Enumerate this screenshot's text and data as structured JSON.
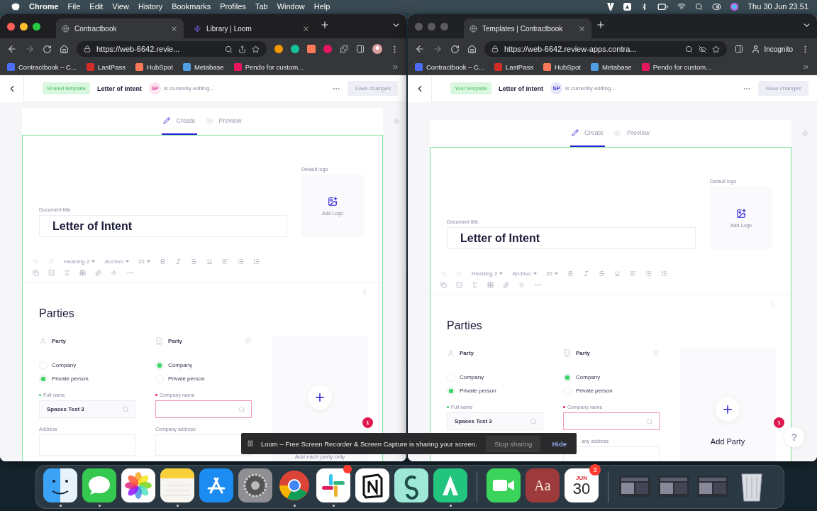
{
  "menubar": {
    "app": "Chrome",
    "menus": [
      "File",
      "Edit",
      "View",
      "History",
      "Bookmarks",
      "Profiles",
      "Tab",
      "Window",
      "Help"
    ],
    "clock": "Thu 30 Jun  23.51"
  },
  "windows": [
    {
      "active": true,
      "incognito": false,
      "tabs": [
        {
          "title": "Contractbook",
          "selected": true,
          "kind": "page"
        },
        {
          "title": "Library | Loom",
          "selected": false,
          "kind": "loom"
        }
      ],
      "url": "https://web-6642.revie...",
      "bookmarks": [
        {
          "label": "Contractbook – C...",
          "color": "#4a6cf7"
        },
        {
          "label": "LastPass",
          "color": "#d32d27"
        },
        {
          "label": "HubSpot",
          "color": "#ff7a59"
        },
        {
          "label": "Metabase",
          "color": "#509ee3"
        },
        {
          "label": "Pendo for custom...",
          "color": "#e8175d"
        }
      ],
      "page": {
        "badge": "Shared template",
        "title": "Letter of Intent",
        "avatar": "SP",
        "editing": "is currently editing...",
        "save": "Save changes",
        "modes": [
          {
            "label": "Create",
            "selected": true,
            "kind": "create"
          },
          {
            "label": "Preview",
            "selected": false,
            "kind": "preview"
          }
        ],
        "logo_label": "Default logo",
        "add_logo": "Add Logo",
        "doc_title_label": "Document title",
        "doc_title": "Letter of Intent",
        "heading": "Heading 2",
        "font": "Archivo",
        "size": "22",
        "section": "Parties",
        "parties": [
          {
            "title": "Party",
            "kind": "person",
            "name_label": "Full name",
            "name_value": "Spaces Test 3",
            "invalid": false,
            "address_label": "Address",
            "options": [
              {
                "label": "Company",
                "selected": false
              },
              {
                "label": "Private person",
                "selected": true
              }
            ]
          },
          {
            "title": "Party",
            "kind": "company",
            "name_label": "Company name",
            "invalid": true,
            "address_label": "Company address",
            "options": [
              {
                "label": "Company",
                "selected": true
              },
              {
                "label": "Private person",
                "selected": false
              }
            ]
          }
        ],
        "add_party": {
          "hint": "Add each party only"
        },
        "notification": "1"
      }
    },
    {
      "active": false,
      "incognito": true,
      "incognito_label": "Incognito",
      "tabs": [
        {
          "title": "Templates | Contractbook",
          "selected": true,
          "kind": "page"
        }
      ],
      "url": "https://web-6642.review-apps.contra...",
      "bookmarks": [
        {
          "label": "Contractbook – C...",
          "color": "#4a6cf7"
        },
        {
          "label": "LastPass",
          "color": "#d32d27"
        },
        {
          "label": "HubSpot",
          "color": "#ff7a59"
        },
        {
          "label": "Metabase",
          "color": "#509ee3"
        },
        {
          "label": "Pendo for custom...",
          "color": "#e8175d"
        }
      ],
      "page": {
        "badge": "Your template",
        "title": "Letter of Intent",
        "avatar": "SP",
        "editing": "is currently editing...",
        "save": "Save changes",
        "modes": [
          {
            "label": "Create",
            "selected": true,
            "kind": "create"
          },
          {
            "label": "Preview",
            "selected": false,
            "kind": "preview"
          }
        ],
        "logo_label": "Default logo",
        "add_logo": "Add Logo",
        "doc_title_label": "Document title",
        "doc_title": "Letter of Intent",
        "heading": "Heading 2",
        "font": "Archivo",
        "size": "22",
        "section": "Parties",
        "parties": [
          {
            "title": "Party",
            "kind": "person",
            "name_label": "Full name",
            "name_value": "Spaces Test 3",
            "invalid": false,
            "options": [
              {
                "label": "Company",
                "selected": false
              },
              {
                "label": "Private person",
                "selected": true
              }
            ]
          },
          {
            "title": "Party",
            "kind": "company",
            "name_label": "Company name",
            "invalid": true,
            "address_label": "any address",
            "options": [
              {
                "label": "Company",
                "selected": true
              },
              {
                "label": "Private person",
                "selected": false
              }
            ]
          }
        ],
        "add_party": {
          "title": "Add Party"
        },
        "notification": "1",
        "help": "?"
      }
    }
  ],
  "loom": {
    "text": "Loom – Free Screen Recorder & Screen Capture is sharing your screen.",
    "stop": "Stop sharing",
    "hide": "Hide"
  },
  "dock": [
    {
      "kind": "finder",
      "running": true
    },
    {
      "kind": "messages",
      "running": true
    },
    {
      "kind": "photos",
      "running": false
    },
    {
      "kind": "notes",
      "running": true
    },
    {
      "kind": "appstore",
      "running": false
    },
    {
      "kind": "settings",
      "running": false
    },
    {
      "kind": "chrome",
      "running": true
    },
    {
      "kind": "slack",
      "running": true,
      "alert": true
    },
    {
      "kind": "notion",
      "running": false
    },
    {
      "kind": "spaces",
      "running": false
    },
    {
      "kind": "greenapp",
      "running": true
    },
    {
      "kind": "separator"
    },
    {
      "kind": "facetime",
      "running": false
    },
    {
      "kind": "dictionary",
      "running": false,
      "label": "Aa"
    },
    {
      "kind": "calendar",
      "running": false,
      "month": "JUN",
      "day": "30",
      "badge": "3"
    },
    {
      "kind": "separator"
    },
    {
      "kind": "thumbnail",
      "running": false
    },
    {
      "kind": "thumbnail",
      "running": false
    },
    {
      "kind": "thumbnail",
      "running": false
    },
    {
      "kind": "trash",
      "running": false
    }
  ]
}
